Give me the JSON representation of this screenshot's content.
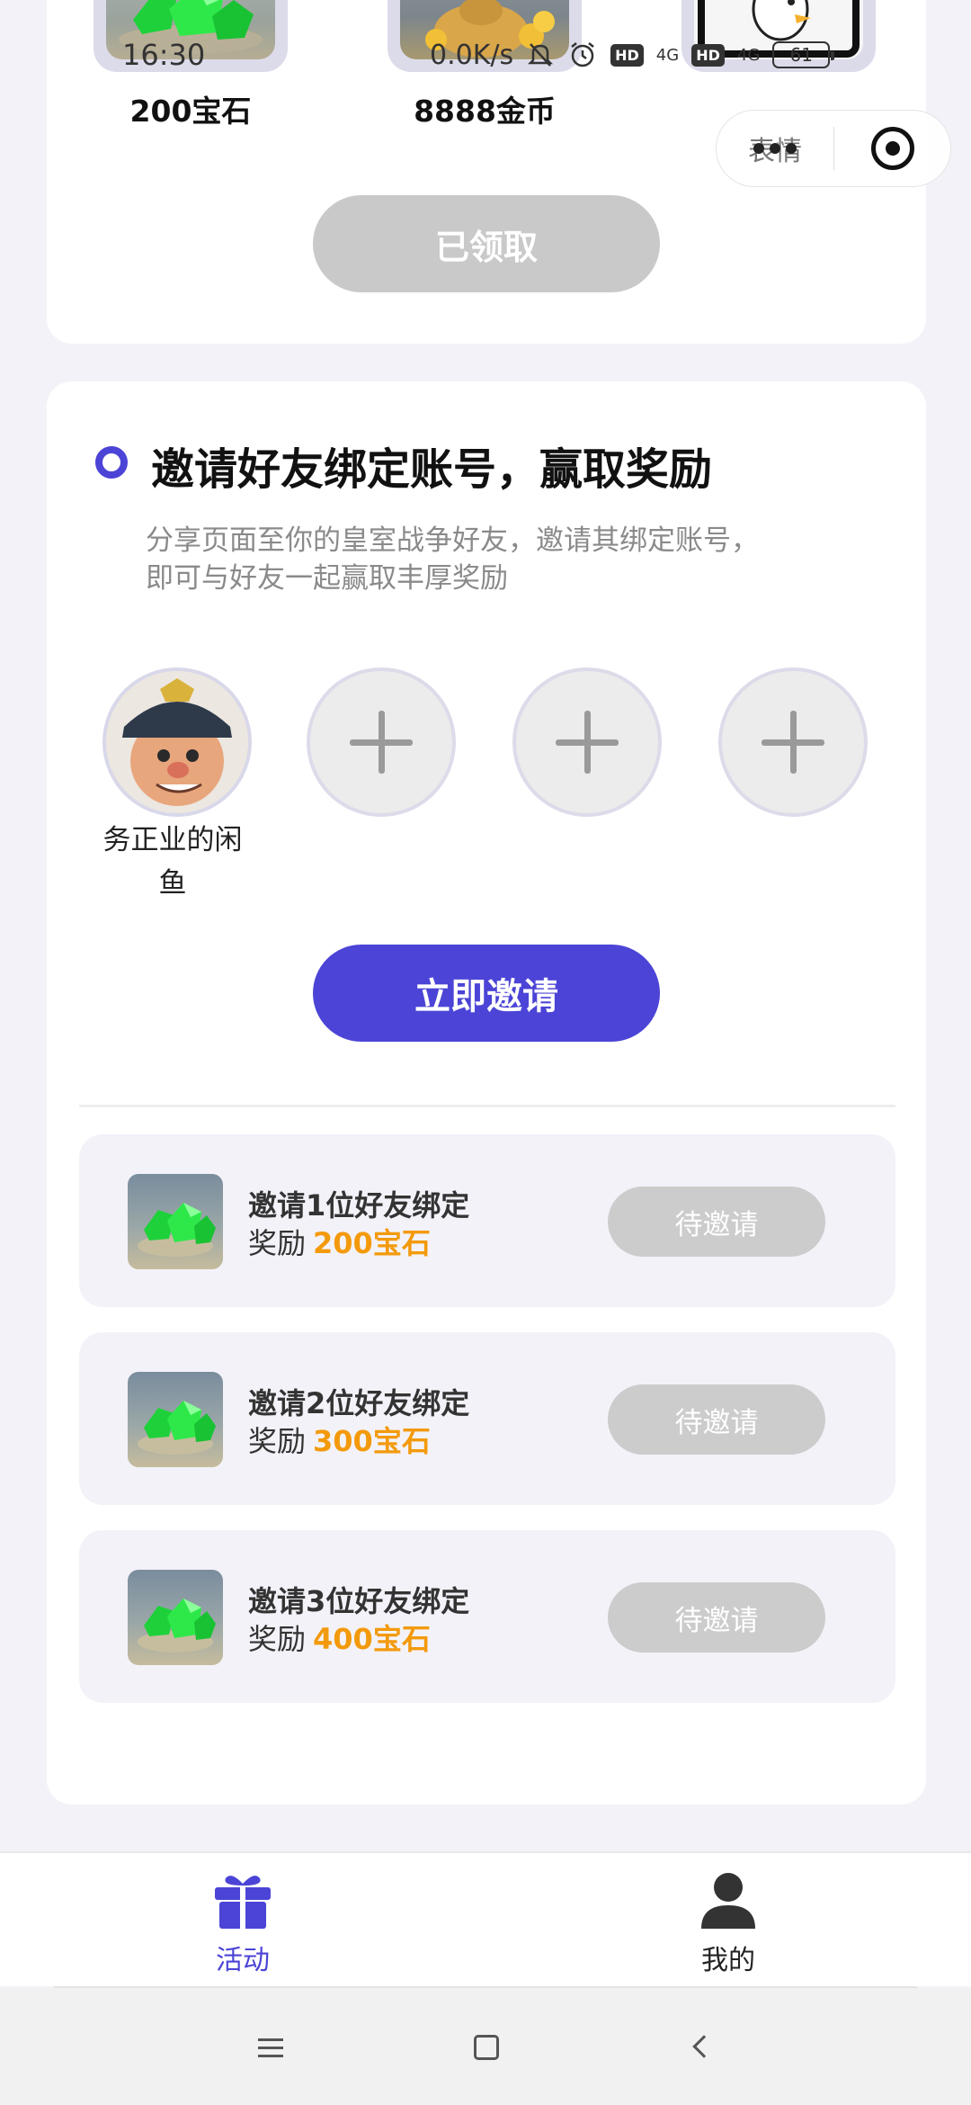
{
  "status_bar": {
    "time": "16:30",
    "net_speed": "0.0K/s",
    "hd1": "HD",
    "net1": "4G",
    "hd2": "HD",
    "net2": "4G",
    "battery": "61"
  },
  "capsule": {
    "more_label": "表情",
    "more_icon": "more-dots-icon",
    "close_icon": "target-icon"
  },
  "rewards": {
    "items": [
      {
        "label": "200宝石",
        "icon": "gem-pile-image"
      },
      {
        "label": "8888金币",
        "icon": "coin-sack-image"
      },
      {
        "label": "",
        "icon": "chicken-emote-image"
      }
    ],
    "claimed_label": "已领取"
  },
  "invite": {
    "title": "邀请好友绑定账号，赢取奖励",
    "desc_line1": "分享页面至你的皇室战争好友，邀请其绑定账号，",
    "desc_line2": "即可与好友一起赢取丰厚奖励",
    "friend_name": "务正业的闲鱼",
    "empty_slot_icon": "plus-icon",
    "invite_button": "立即邀请",
    "tiers": [
      {
        "title": "邀请1位好友绑定",
        "reward_prefix": "奖励",
        "reward": "200宝石",
        "status": "待邀请"
      },
      {
        "title": "邀请2位好友绑定",
        "reward_prefix": "奖励",
        "reward": "300宝石",
        "status": "待邀请"
      },
      {
        "title": "邀请3位好友绑定",
        "reward_prefix": "奖励",
        "reward": "400宝石",
        "status": "待邀请"
      }
    ]
  },
  "tabbar": {
    "tabs": [
      {
        "label": "活动",
        "icon": "gift-icon",
        "active": true
      },
      {
        "label": "我的",
        "icon": "person-icon",
        "active": false
      }
    ]
  },
  "system_nav": {
    "buttons": [
      "menu-icon",
      "home-icon",
      "back-icon"
    ]
  },
  "colors": {
    "accent": "#4b44d6",
    "reward_amount": "#f39a0c",
    "disabled_button": "#cccccc",
    "background": "#f3f2f8"
  }
}
